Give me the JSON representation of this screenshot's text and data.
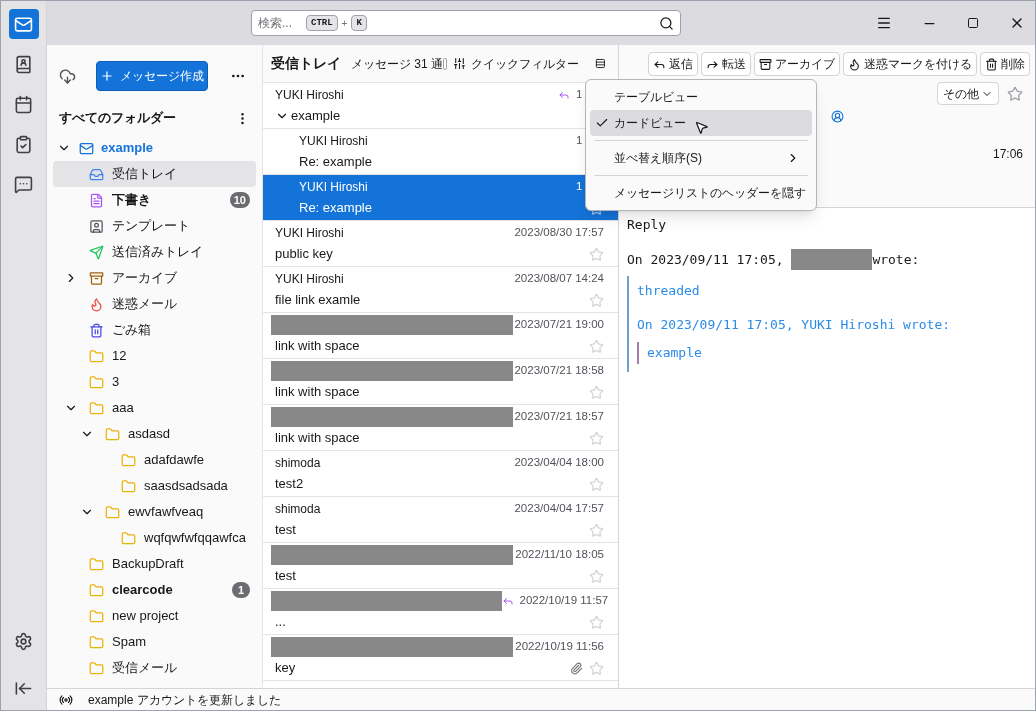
{
  "search": {
    "placeholder": "検索...",
    "keys": [
      "CTRL",
      "+",
      "K"
    ]
  },
  "spaces": [
    {
      "kind": "mail",
      "selected": true
    },
    {
      "kind": "contacts",
      "selected": false
    },
    {
      "kind": "calendar",
      "selected": false
    },
    {
      "kind": "tasks",
      "selected": false
    },
    {
      "kind": "chat",
      "selected": false
    }
  ],
  "folder_pane": {
    "compose": "メッセージ作成",
    "heading": "すべてのフォルダー",
    "account": {
      "name": "example",
      "expanded": true,
      "folders": [
        {
          "kind": "inbox",
          "name": "受信トレイ",
          "selected": true,
          "unread": false
        },
        {
          "kind": "drafts",
          "name": "下書き",
          "selected": false,
          "unread": true,
          "count": "10"
        },
        {
          "kind": "templates",
          "name": "テンプレート",
          "selected": false,
          "unread": false
        },
        {
          "kind": "sent",
          "name": "送信済みトレイ",
          "selected": false,
          "unread": false
        },
        {
          "kind": "archive",
          "name": "アーカイブ",
          "selected": false,
          "unread": false,
          "expanded": false
        },
        {
          "kind": "junk",
          "name": "迷惑メール",
          "selected": false,
          "unread": false
        },
        {
          "kind": "trash",
          "name": "ごみ箱",
          "selected": false,
          "unread": false
        },
        {
          "kind": "folder",
          "name": "12",
          "selected": false,
          "unread": false
        },
        {
          "kind": "folder",
          "name": "3",
          "selected": false,
          "unread": false
        },
        {
          "kind": "folder",
          "name": "aaa",
          "selected": false,
          "unread": false,
          "expanded": true,
          "children": [
            {
              "kind": "folder",
              "name": "asdasd",
              "selected": false,
              "unread": false,
              "expanded": true,
              "children": [
                {
                  "kind": "folder",
                  "name": "adafdawfe",
                  "selected": false,
                  "unread": false
                },
                {
                  "kind": "folder",
                  "name": "saasdsadsada",
                  "selected": false,
                  "unread": false
                }
              ]
            },
            {
              "kind": "folder",
              "name": "ewvfawfveaq",
              "selected": false,
              "unread": false,
              "expanded": true,
              "children": [
                {
                  "kind": "folder",
                  "name": "wqfqwfwfqqawfca",
                  "selected": false,
                  "unread": false
                }
              ]
            }
          ]
        },
        {
          "kind": "folder",
          "name": "BackupDraft",
          "selected": false,
          "unread": false
        },
        {
          "kind": "folder",
          "name": "clearcode",
          "selected": false,
          "unread": true,
          "count": "1"
        },
        {
          "kind": "folder",
          "name": "new project",
          "selected": false,
          "unread": false
        },
        {
          "kind": "folder",
          "name": "Spam",
          "selected": false,
          "unread": false
        },
        {
          "kind": "folder",
          "name": "受信メール",
          "selected": false,
          "unread": false
        }
      ]
    }
  },
  "message_list": {
    "title": "受信トレイ",
    "count": "メッセージ 31 通",
    "quick_filter": "クイックフィルター",
    "quick_filter_pinned": false,
    "messages": [
      {
        "sender": "YUKI Hiroshi",
        "subject": "example",
        "date": "1",
        "replied": true,
        "expanded": true,
        "selected": false,
        "children": [
          {
            "sender": "YUKI Hiroshi",
            "subject": "Re: example",
            "date": "1",
            "selected": false
          },
          {
            "sender": "YUKI Hiroshi",
            "subject": "Re: example",
            "date": "1",
            "selected": true,
            "starred": false
          }
        ]
      },
      {
        "sender": "YUKI Hiroshi",
        "subject": "public key",
        "date": "2023/08/30 17:57",
        "selected": false,
        "starred": false
      },
      {
        "sender": "YUKI Hiroshi",
        "subject": "file link examle",
        "date": "2023/08/07 14:24",
        "selected": false,
        "starred": false
      },
      {
        "redacted": true,
        "subject": "link with space",
        "date": "2023/07/21 19:00",
        "selected": false,
        "starred": false
      },
      {
        "redacted": true,
        "subject": "link with space",
        "date": "2023/07/21 18:58",
        "selected": false,
        "starred": false
      },
      {
        "redacted": true,
        "subject": "link with space",
        "date": "2023/07/21 18:57",
        "selected": false,
        "starred": false
      },
      {
        "sender": "shimoda",
        "subject": "test2",
        "date": "2023/04/04 18:00",
        "selected": false,
        "starred": false
      },
      {
        "sender": "shimoda",
        "subject": "test",
        "date": "2023/04/04 17:57",
        "selected": false,
        "starred": false
      },
      {
        "redacted": true,
        "subject": "test",
        "date": "2022/11/10 18:05",
        "selected": false,
        "starred": false
      },
      {
        "redacted": true,
        "subject": "...",
        "date": "2022/10/19 11:57",
        "replied": true,
        "selected": false,
        "starred": false
      },
      {
        "redacted": true,
        "subject": "key",
        "date": "2022/10/19 11:56",
        "attachment": true,
        "selected": false,
        "starred": false
      }
    ]
  },
  "view_menu": {
    "items": [
      {
        "kind": "item",
        "label": "テーブルビュー",
        "checked": false,
        "hovered": false
      },
      {
        "kind": "item",
        "label": "カードビュー",
        "checked": true,
        "hovered": true
      },
      {
        "kind": "separator"
      },
      {
        "kind": "submenu",
        "label": "並べ替え順序(S)",
        "hovered": false
      },
      {
        "kind": "separator"
      },
      {
        "kind": "item",
        "label": "メッセージリストのヘッダーを隠す",
        "checked": false,
        "hovered": false
      }
    ]
  },
  "reader": {
    "actions": [
      {
        "kind": "reply",
        "label": "返信"
      },
      {
        "kind": "forward",
        "label": "転送"
      },
      {
        "kind": "archive",
        "label": "アーカイブ"
      },
      {
        "kind": "junk",
        "label": "迷惑マークを付ける"
      },
      {
        "kind": "delete",
        "label": "削除"
      }
    ],
    "more": "その他",
    "starred": false,
    "time": "17:06",
    "body": {
      "first": "Reply",
      "attribution": {
        "prefix": "On 2023/09/11 17:05, ",
        "redacted": true,
        "suffix": "wrote:"
      },
      "quote": {
        "lines": [
          "threaded",
          "On 2023/09/11 17:05, YUKI Hiroshi wrote:"
        ],
        "nested": "example"
      }
    }
  },
  "status_bar": {
    "text": "example アカウントを更新しました"
  }
}
